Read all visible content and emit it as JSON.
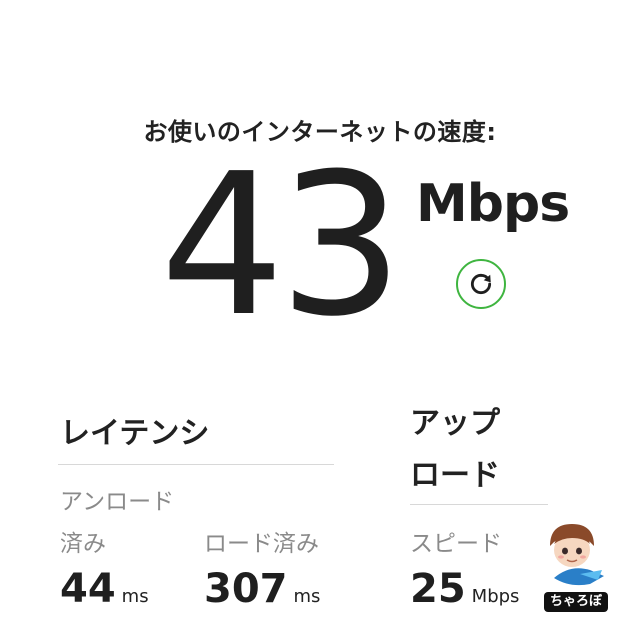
{
  "header": {
    "title": "お使いのインターネットの速度:"
  },
  "speed": {
    "value": "43",
    "unit": "Mbps"
  },
  "latency": {
    "title": "レイテンシ",
    "label_line1": "アンロード",
    "label_line2": "済み",
    "loaded_label": "ロード済み",
    "unloaded": {
      "value": "44",
      "unit": "ms"
    },
    "loaded": {
      "value": "307",
      "unit": "ms"
    }
  },
  "upload": {
    "title_line1": "アップ",
    "title_line2": "ロード",
    "label": "スピード",
    "speed": {
      "value": "25",
      "unit": "Mbps"
    }
  },
  "watermark": {
    "label": "ちゃろぼ"
  },
  "colors": {
    "accent_green": "#3fb540",
    "text": "#222222",
    "muted": "#8a8a8a"
  },
  "icons": {
    "refresh": "refresh-icon"
  }
}
